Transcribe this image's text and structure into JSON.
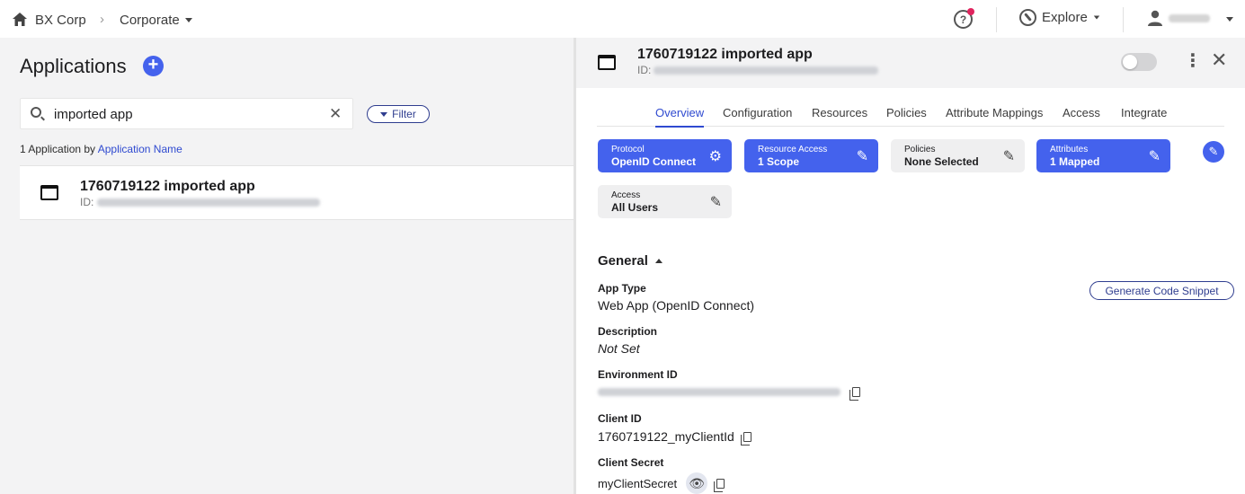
{
  "topbar": {
    "org": "BX Corp",
    "environment": "Corporate",
    "explore": "Explore",
    "has_notification": true,
    "user_name_redacted": true
  },
  "list": {
    "title": "Applications",
    "search_value": "imported app",
    "filter_label": "Filter",
    "result_prefix": "1 Application by",
    "result_sort": "Application Name",
    "apps": [
      {
        "name": "1760719122 imported app",
        "id_label": "ID:"
      }
    ]
  },
  "detail": {
    "title": "1760719122 imported app",
    "id_label": "ID:",
    "enabled": false,
    "tabs": [
      "Overview",
      "Configuration",
      "Resources",
      "Policies",
      "Attribute Mappings",
      "Access",
      "Integrate"
    ],
    "active_tab": "Overview",
    "cards": [
      {
        "label": "Protocol",
        "value": "OpenID Connect",
        "icon": "gears-icon",
        "style": "blue"
      },
      {
        "label": "Resource Access",
        "value": "1 Scope",
        "icon": "pencil-icon",
        "style": "blue"
      },
      {
        "label": "Policies",
        "value": "None Selected",
        "icon": "pencil-icon",
        "style": "grey"
      },
      {
        "label": "Attributes",
        "value": "1 Mapped",
        "icon": "pencil-icon",
        "style": "blue"
      },
      {
        "label": "Access",
        "value": "All Users",
        "icon": "pencil-icon",
        "style": "grey"
      }
    ],
    "section_title": "General",
    "snippet_button": "Generate Code Snippet",
    "fields": {
      "app_type_label": "App Type",
      "app_type_value": "Web App (OpenID Connect)",
      "description_label": "Description",
      "description_value": "Not Set",
      "environment_id_label": "Environment ID",
      "client_id_label": "Client ID",
      "client_id_value": "1760719122_myClientId",
      "client_secret_label": "Client Secret",
      "client_secret_value": "myClientSecret"
    }
  },
  "colors": {
    "accent": "#4462ed",
    "link": "#2f4ad0",
    "notification": "#e0245e"
  }
}
